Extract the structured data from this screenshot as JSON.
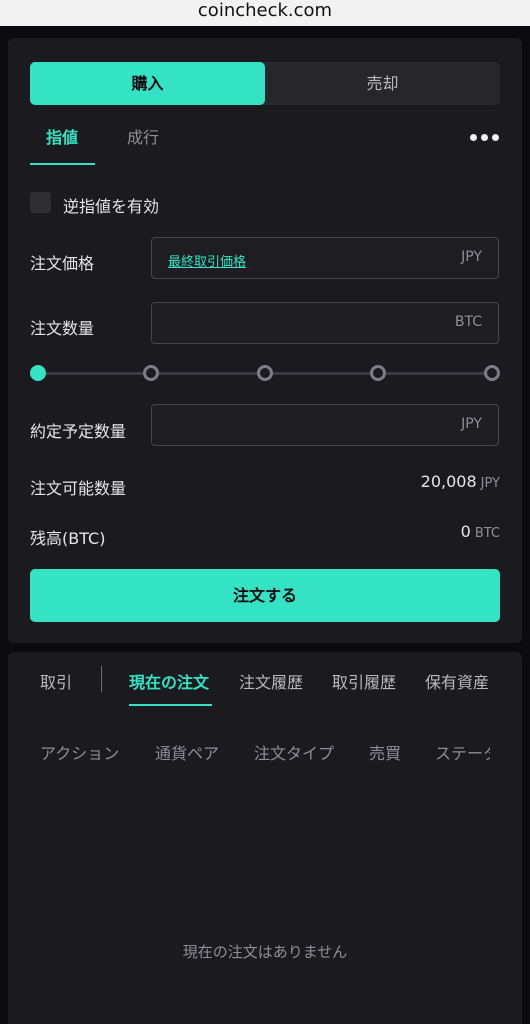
{
  "browser": {
    "url": "coincheck.com"
  },
  "order": {
    "side_tabs": {
      "buy": "購入",
      "sell": "売却"
    },
    "type_tabs": {
      "limit": "指値",
      "market": "成行",
      "active": "limit"
    },
    "stop_checkbox": {
      "label": "逆指値を有効",
      "checked": false
    },
    "price": {
      "label": "注文価格",
      "link": "最終取引価格",
      "unit": "JPY"
    },
    "amount": {
      "label": "注文数量",
      "unit": "BTC"
    },
    "slider": {
      "value_percent": 0,
      "stops": 5
    },
    "estimate": {
      "label": "約定予定数量",
      "unit": "JPY"
    },
    "available": {
      "label": "注文可能数量",
      "value": "20,008",
      "unit": "JPY"
    },
    "balance": {
      "label": "残高(BTC)",
      "value": "0",
      "unit": "BTC"
    },
    "submit_label": "注文する"
  },
  "bottom": {
    "tabs": [
      "取引",
      "現在の注文",
      "注文履歴",
      "取引履歴",
      "保有資産"
    ],
    "active_tab": "現在の注文",
    "columns": [
      "アクション",
      "通貨ペア",
      "注文タイプ",
      "売買",
      "ステータス"
    ],
    "empty_message": "現在の注文はありません"
  },
  "colors": {
    "accent": "#34e3c4",
    "panel": "#1b1b1f",
    "background": "#0b0b0d"
  }
}
